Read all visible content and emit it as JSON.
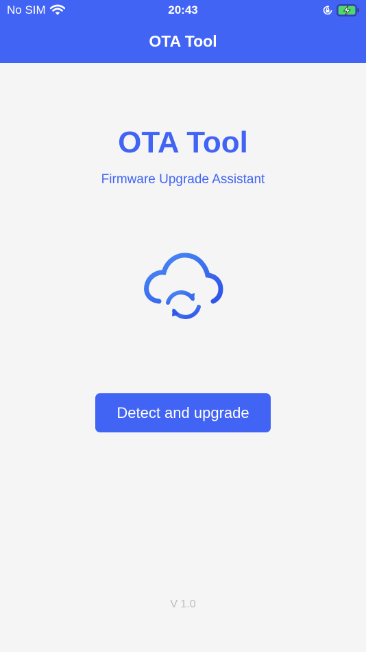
{
  "status_bar": {
    "carrier": "No SIM",
    "time": "20:43",
    "wifi_icon": "wifi-icon",
    "orientation_icon": "orientation-lock-icon",
    "battery_icon": "battery-charging-icon",
    "battery_color": "#4cd964"
  },
  "nav": {
    "title": "OTA Tool"
  },
  "main": {
    "title": "OTA Tool",
    "subtitle": "Firmware Upgrade Assistant",
    "hero_icon": "cloud-sync-icon",
    "action_button": "Detect and upgrade"
  },
  "footer": {
    "version": "V 1.0"
  },
  "colors": {
    "accent": "#4264f5",
    "background": "#f5f5f5",
    "muted_text": "#bdbdbd"
  }
}
